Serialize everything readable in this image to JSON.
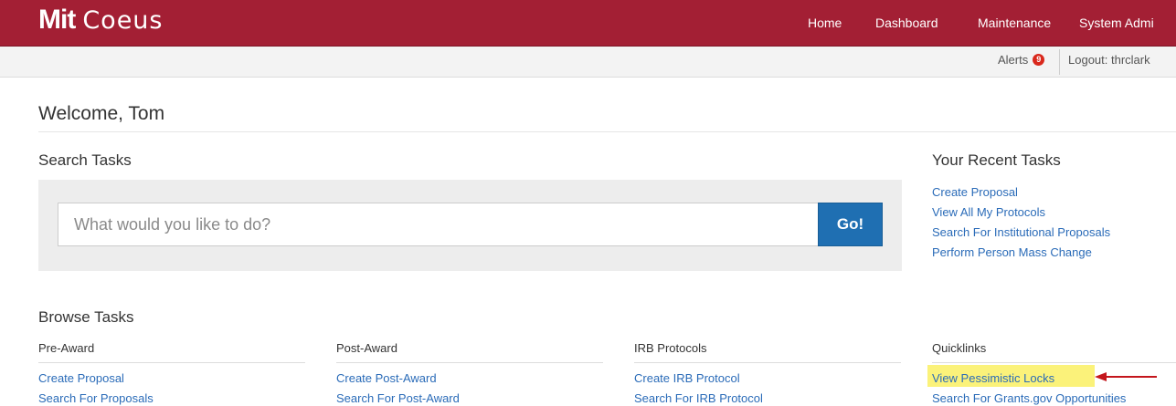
{
  "header": {
    "logo_mark": "Mit",
    "logo_text": "Coeus",
    "nav": [
      "Home",
      "Dashboard",
      "Maintenance",
      "System Admi"
    ]
  },
  "subbar": {
    "alerts_label": "Alerts",
    "alerts_count": "9",
    "logout_label": "Logout: thrclark"
  },
  "welcome": "Welcome, Tom",
  "search": {
    "title": "Search Tasks",
    "placeholder": "What would you like to do?",
    "go_label": "Go!"
  },
  "recent": {
    "title": "Your Recent Tasks",
    "items": [
      "Create Proposal",
      "View All My Protocols",
      "Search For Institutional Proposals",
      "Perform Person Mass Change"
    ]
  },
  "browse": {
    "title": "Browse Tasks",
    "columns": [
      {
        "header": "Pre-Award",
        "items": [
          "Create Proposal",
          "Search For Proposals"
        ]
      },
      {
        "header": "Post-Award",
        "items": [
          "Create Post-Award",
          "Search For Post-Award"
        ]
      },
      {
        "header": "IRB Protocols",
        "items": [
          "Create IRB Protocol",
          "Search For IRB Protocol"
        ]
      },
      {
        "header": "Quicklinks",
        "items": [
          "View Pessimistic Locks",
          "Search For Grants.gov Opportunities"
        ]
      }
    ]
  },
  "colors": {
    "brand": "#a31f34",
    "link": "#2a6bb8",
    "go_button": "#1f6fb2",
    "highlight": "#fbf27a",
    "annotation_arrow": "#c4161c"
  }
}
